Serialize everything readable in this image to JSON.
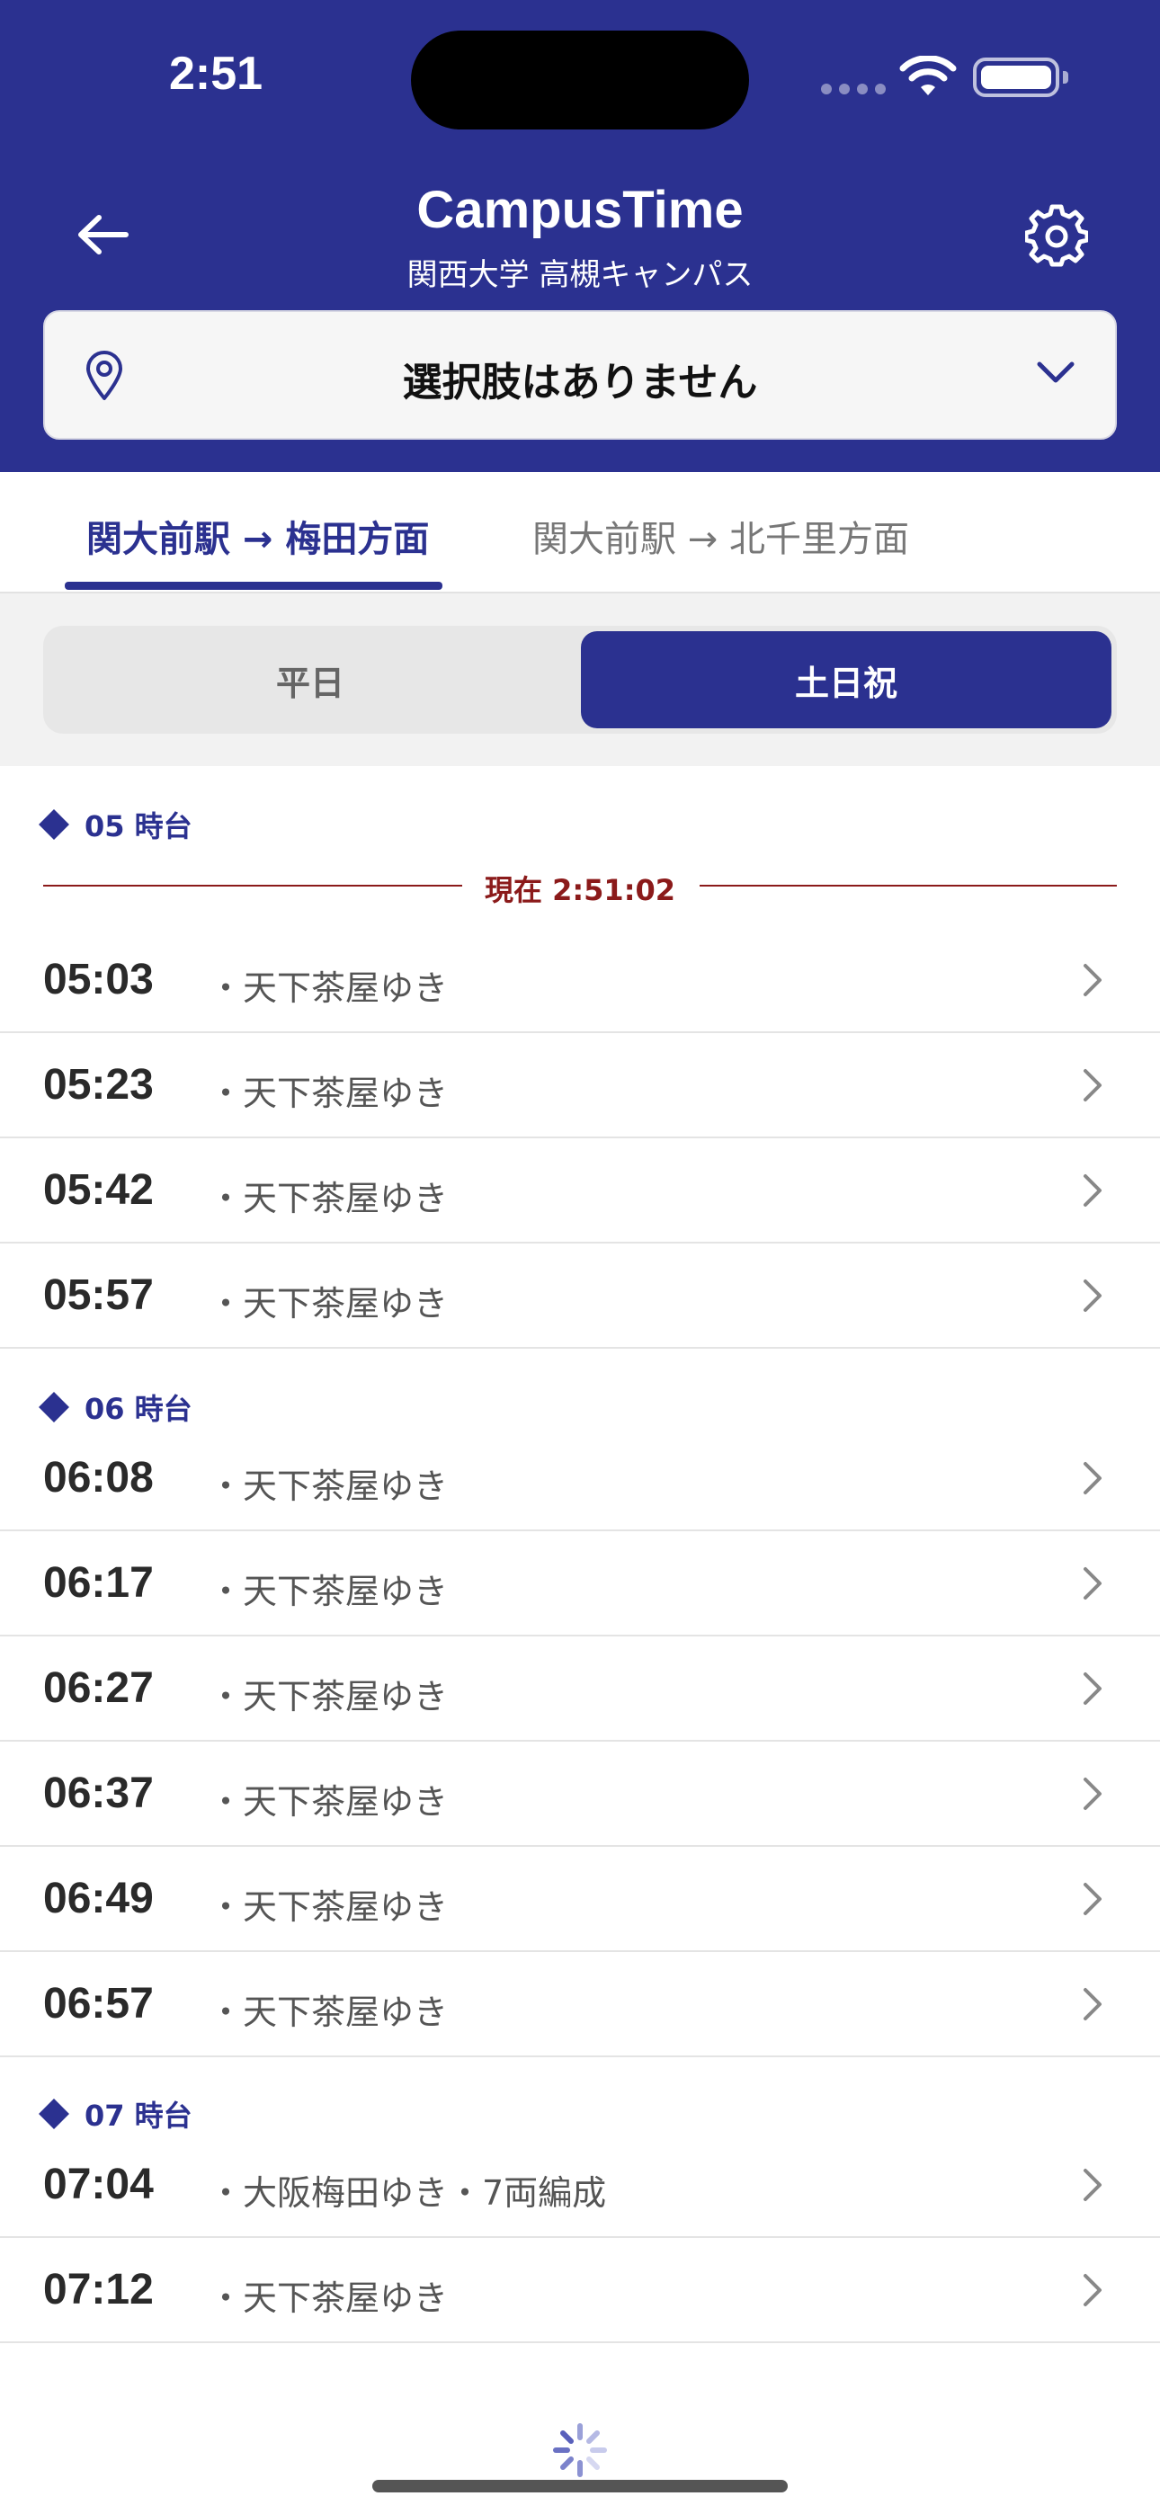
{
  "status": {
    "time": "2:51"
  },
  "header": {
    "title": "CampusTime",
    "subtitle": "関西大学 高槻キャンパス",
    "selector_label": "選択肢はありません"
  },
  "tabs": [
    {
      "label": "関大前駅 → 梅田方面",
      "active": true
    },
    {
      "label": "関大前駅 → 北千里方面",
      "active": false
    }
  ],
  "segment": {
    "weekday": "平日",
    "holiday": "土日祝",
    "selected": "土日祝"
  },
  "now_indicator": "現在 2:51:02",
  "sections": [
    {
      "label": "05 時台"
    },
    {
      "label": "06 時台"
    },
    {
      "label": "07 時台"
    }
  ],
  "departures": [
    {
      "time": "05:03",
      "dest": "・天下茶屋ゆき"
    },
    {
      "time": "05:23",
      "dest": "・天下茶屋ゆき"
    },
    {
      "time": "05:42",
      "dest": "・天下茶屋ゆき"
    },
    {
      "time": "05:57",
      "dest": "・天下茶屋ゆき"
    },
    {
      "time": "06:08",
      "dest": "・天下茶屋ゆき"
    },
    {
      "time": "06:17",
      "dest": "・天下茶屋ゆき"
    },
    {
      "time": "06:27",
      "dest": "・天下茶屋ゆき"
    },
    {
      "time": "06:37",
      "dest": "・天下茶屋ゆき"
    },
    {
      "time": "06:49",
      "dest": "・天下茶屋ゆき"
    },
    {
      "time": "06:57",
      "dest": "・天下茶屋ゆき"
    },
    {
      "time": "07:04",
      "dest": "・大阪梅田ゆき・7両編成"
    },
    {
      "time": "07:12",
      "dest": "・天下茶屋ゆき"
    }
  ],
  "colors": {
    "brand": "#2b3190",
    "now_indicator": "#8b1a1a"
  }
}
